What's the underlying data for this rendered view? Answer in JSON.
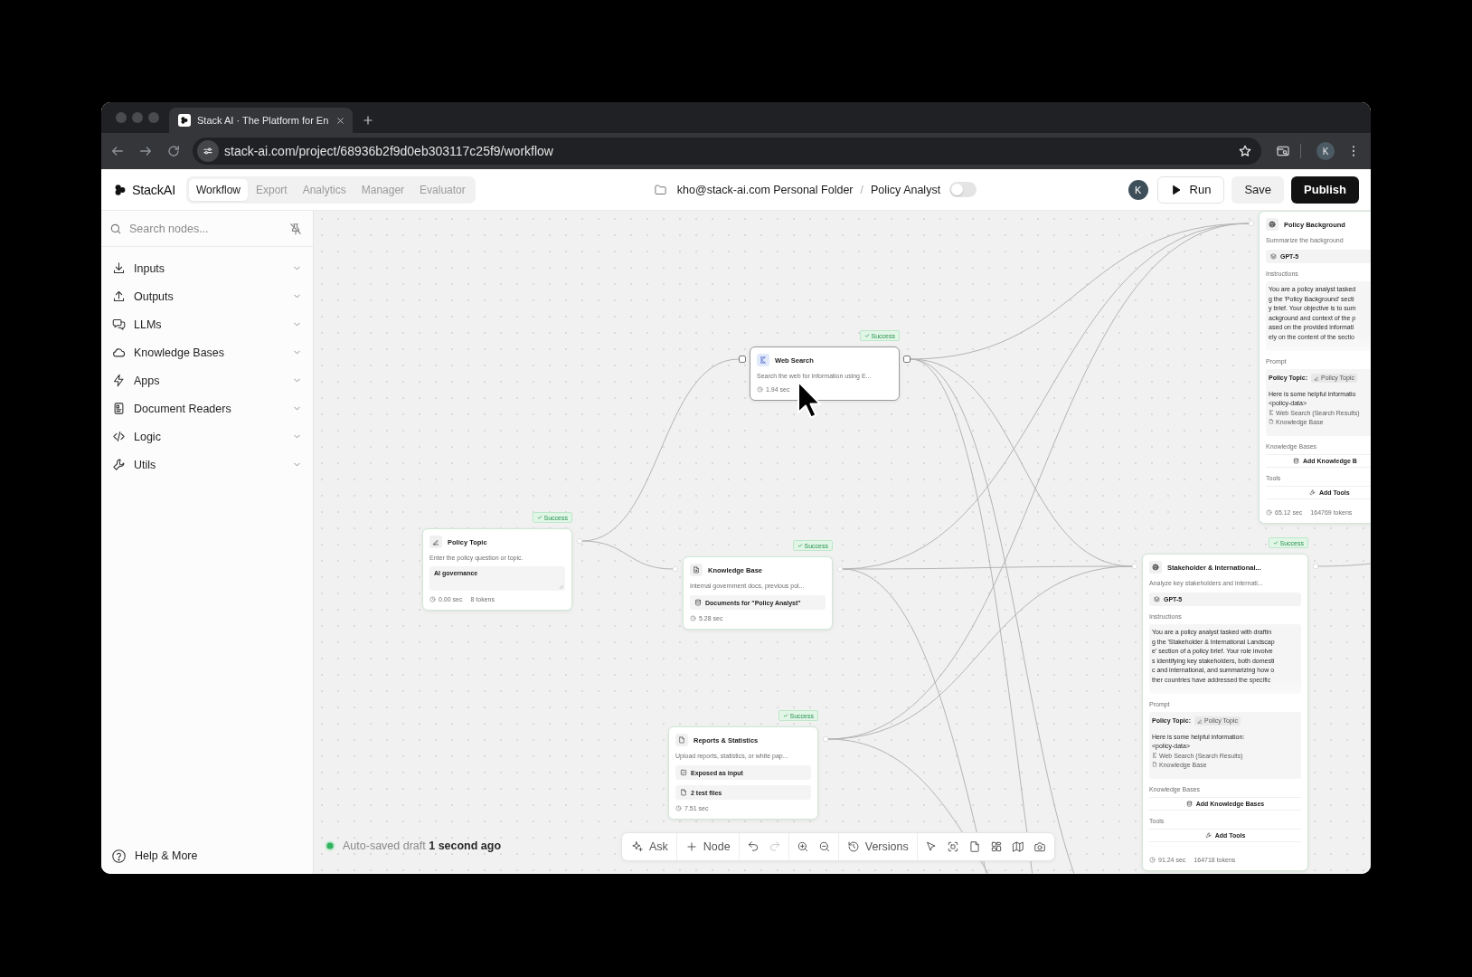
{
  "browser": {
    "tab_title": "Stack AI · The Platform for En",
    "url": "stack-ai.com/project/68936b2f9d0eb303117c25f9/workflow",
    "profile_initial": "K"
  },
  "header": {
    "brand": "StackAI",
    "tabs": [
      {
        "label": "Workflow",
        "selected": true
      },
      {
        "label": "Export",
        "selected": false
      },
      {
        "label": "Analytics",
        "selected": false
      },
      {
        "label": "Manager",
        "selected": false
      },
      {
        "label": "Evaluator",
        "selected": false
      }
    ],
    "folder": "kho@stack-ai.com Personal Folder",
    "separator": "/",
    "project": "Policy Analyst",
    "toggle": {
      "on": false
    },
    "avatar_initial": "K",
    "buttons": [
      {
        "kind": "run",
        "label": "Run"
      },
      {
        "kind": "secondary",
        "label": "Save"
      },
      {
        "kind": "primary",
        "label": "Publish"
      }
    ]
  },
  "sidebar": {
    "search": {
      "placeholder": "Search nodes..."
    },
    "items": [
      {
        "label": "Inputs",
        "expanded": false
      },
      {
        "label": "Outputs",
        "expanded": false
      },
      {
        "label": "LLMs",
        "expanded": false
      },
      {
        "label": "Knowledge Bases",
        "expanded": false
      },
      {
        "label": "Apps",
        "expanded": false
      },
      {
        "label": "Document Readers",
        "expanded": false
      },
      {
        "label": "Logic",
        "expanded": false
      },
      {
        "label": "Utils",
        "expanded": false
      }
    ],
    "help": "Help & More"
  },
  "canvas": {
    "nodes": [
      {
        "kind": "input",
        "title": "Policy Topic",
        "badge": "Success",
        "hovered": false,
        "description": "Enter the policy question or topic.",
        "value": "AI governance",
        "stats": [
          "0.00 sec",
          "8 tokens"
        ]
      },
      {
        "kind": "web_search",
        "title": "Web Search",
        "badge": "Success",
        "hovered": true,
        "description": "Search the web for information using E...",
        "stats": [
          "1.94 sec"
        ]
      },
      {
        "kind": "knowledge_base",
        "title": "Knowledge Base",
        "badge": "Success",
        "hovered": false,
        "description": "Internal government docs, previous pol...",
        "rows": [
          {
            "kind": "database",
            "text": "Documents for \"Policy Analyst\""
          }
        ],
        "stats": [
          "5.28 sec"
        ]
      },
      {
        "kind": "files",
        "title": "Reports & Statistics",
        "badge": "Success",
        "hovered": false,
        "description": "Upload reports, statistics, or white pap...",
        "rows": [
          {
            "kind": "checkbox",
            "checked": true,
            "text": "Exposed as input"
          },
          {
            "kind": "file",
            "text": "2 test files"
          }
        ],
        "stats": [
          "7.51 sec"
        ]
      },
      {
        "kind": "llm",
        "title": "Stakeholder & International...",
        "badge": "Success",
        "hovered": false,
        "description": "Analyze key stakeholders and internati...",
        "model": "GPT-5",
        "instructions_label": "Instructions",
        "instructions": [
          "You are a policy analyst tasked with draftin",
          "g the 'Stakeholder & International Landscap",
          "e' section of a policy brief. Your role involve",
          "s identifying key stakeholders, both domesti",
          "c and international, and summarizing how o",
          "ther countries have addressed the specific"
        ],
        "prompt_label": "Prompt",
        "prompt": {
          "topic_label": "Policy Topic:",
          "topic_chip": "Policy Topic",
          "lines": [
            "Here is some helpful information:",
            "<policy-data>"
          ],
          "refs": [
            {
              "kind": "web_search",
              "text": "Web Search (Search Results)"
            },
            {
              "kind": "knowledge_base",
              "text": "Knowledge Base"
            }
          ]
        },
        "knowledge_label": "Knowledge Bases",
        "knowledge_button": "Add Knowledge Bases",
        "tools_label": "Tools",
        "tools_button": "Add Tools",
        "stats": [
          "91.24 sec",
          "164718 tokens"
        ]
      },
      {
        "kind": "llm",
        "title": "Policy Background",
        "hovered": false,
        "description": "Summarize the background",
        "model": "GPT-5",
        "instructions_label": "Instructions",
        "instructions": [
          "You are a policy analyst tasked",
          "g the 'Policy Background' secti",
          "y brief. Your objective is to sum",
          "ackground and context of the p",
          "ased on the provided informati",
          "ely on the content of the sectio"
        ],
        "prompt_label": "Prompt",
        "prompt": {
          "topic_label": "Policy Topic:",
          "topic_chip": "Policy Topic",
          "lines": [
            "Here is some helpful informatio",
            "<policy-data>"
          ],
          "refs": [
            {
              "kind": "web_search",
              "text": "Web Search (Search Results)"
            },
            {
              "kind": "knowledge_base",
              "text": "Knowledge Base"
            }
          ]
        },
        "knowledge_label": "Knowledge Bases",
        "knowledge_button": "Add Knowledge B",
        "tools_label": "Tools",
        "tools_button": "Add Tools",
        "stats": [
          "65.12 sec",
          "164769 tokens"
        ]
      }
    ],
    "status": "Auto-saved draft **1 second ago**",
    "toolbar": {
      "ask": "Ask",
      "node": "Node",
      "undo": {
        "disabled": false
      },
      "redo": {
        "disabled": true
      },
      "versions": "Versions"
    }
  }
}
